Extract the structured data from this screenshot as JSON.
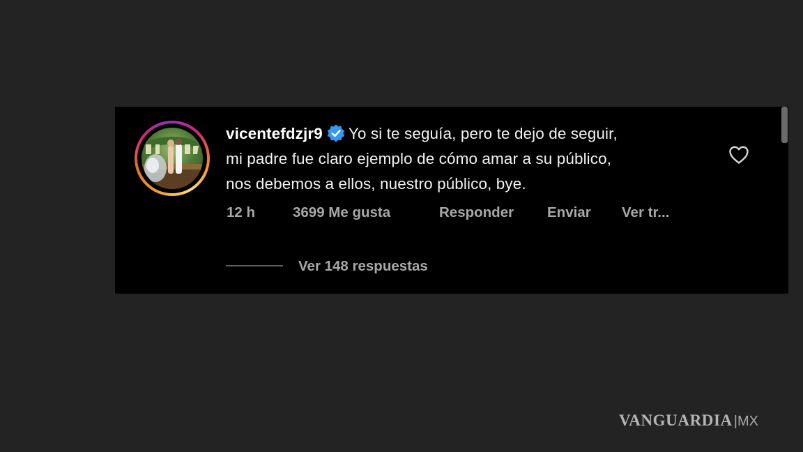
{
  "comment": {
    "username": "vicentefdzjr9",
    "text_line1": "Yo si te seguía, pero te dejo de seguir,",
    "text_line2": "mi padre fue claro ejemplo de cómo amar a su público,",
    "text_line3": "nos debemos a ellos, nuestro público, bye.",
    "verified": true,
    "avatar_icon": "profile-photo",
    "avatar_ring_colors": [
      "#feda75",
      "#f58529",
      "#d62976",
      "#962fbf"
    ],
    "time": "12 h",
    "likes": "3699 Me gusta",
    "reply_label": "Responder",
    "send_label": "Enviar",
    "translate_label": "Ver tr...",
    "view_replies": "Ver 148 respuestas",
    "like_icon": "heart-outline-icon"
  },
  "watermark": {
    "brand": "VANGUARDIA",
    "suffix": "MX"
  },
  "colors": {
    "page_background": "#232323",
    "card_background": "#000000",
    "verified_badge": "#3897f0",
    "meta_text": "#a8a8a8"
  }
}
